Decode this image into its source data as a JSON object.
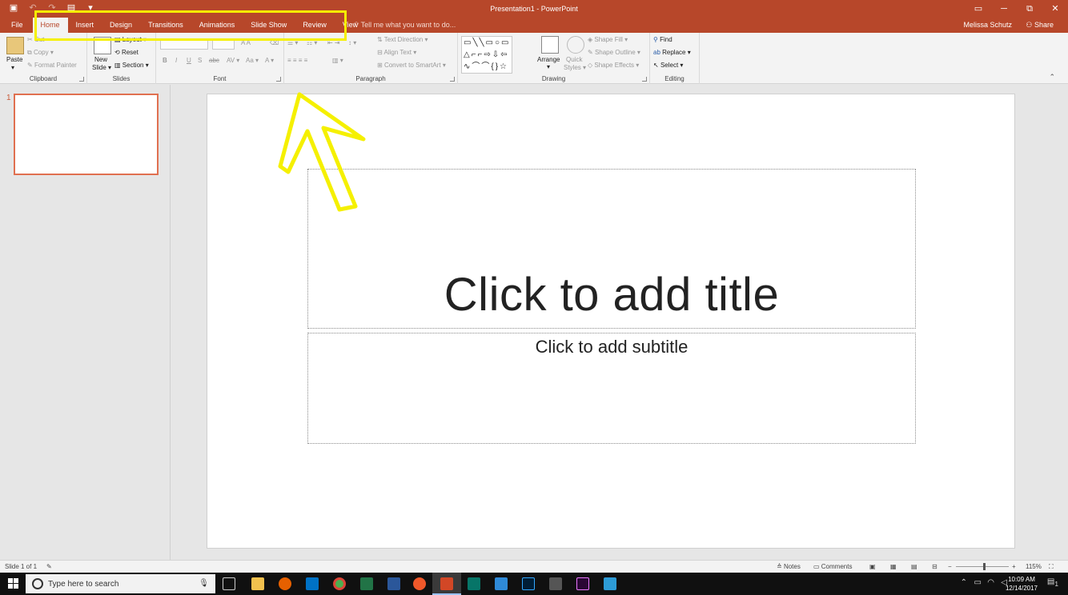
{
  "window": {
    "title": "Presentation1 - PowerPoint",
    "user": "Melissa Schutz",
    "share_label": "Share",
    "controls": [
      "▭",
      "⧉",
      "✕"
    ]
  },
  "tabs": [
    "File",
    "Home",
    "Insert",
    "Design",
    "Transitions",
    "Animations",
    "Slide Show",
    "Review",
    "View"
  ],
  "active_tab": "Home",
  "tellme": "Tell me what you want to do...",
  "ribbon": {
    "clipboard": {
      "label": "Clipboard",
      "paste": "Paste",
      "cut": "Cut",
      "copy": "Copy",
      "format_painter": "Format Painter"
    },
    "slides": {
      "label": "Slides",
      "new_slide": "New",
      "new_slide_2": "Slide",
      "layout": "Layout",
      "reset": "Reset",
      "section": "Section"
    },
    "font": {
      "label": "Font"
    },
    "paragraph": {
      "label": "Paragraph",
      "text_direction": "Text Direction",
      "align_text": "Align Text",
      "convert_smartart": "Convert to SmartArt"
    },
    "drawing": {
      "label": "Drawing",
      "arrange": "Arrange",
      "quick": "Quick",
      "styles": "Styles",
      "shape_fill": "Shape Fill",
      "shape_outline": "Shape Outline",
      "shape_effects": "Shape Effects"
    },
    "editing": {
      "label": "Editing",
      "find": "Find",
      "replace": "Replace",
      "select": "Select"
    }
  },
  "thumbnails": {
    "number": "1"
  },
  "slide": {
    "title_placeholder": "Click to add title",
    "subtitle_placeholder": "Click to add subtitle"
  },
  "statusbar": {
    "slide_info": "Slide 1 of 1",
    "notes": "Notes",
    "comments": "Comments",
    "zoom": "115%"
  },
  "taskbar": {
    "search_placeholder": "Type here to search",
    "time": "10:09 AM",
    "date": "12/14/2017",
    "notification_count": "1"
  },
  "colors": {
    "accent": "#b7472a",
    "highlight": "#f5f000"
  }
}
